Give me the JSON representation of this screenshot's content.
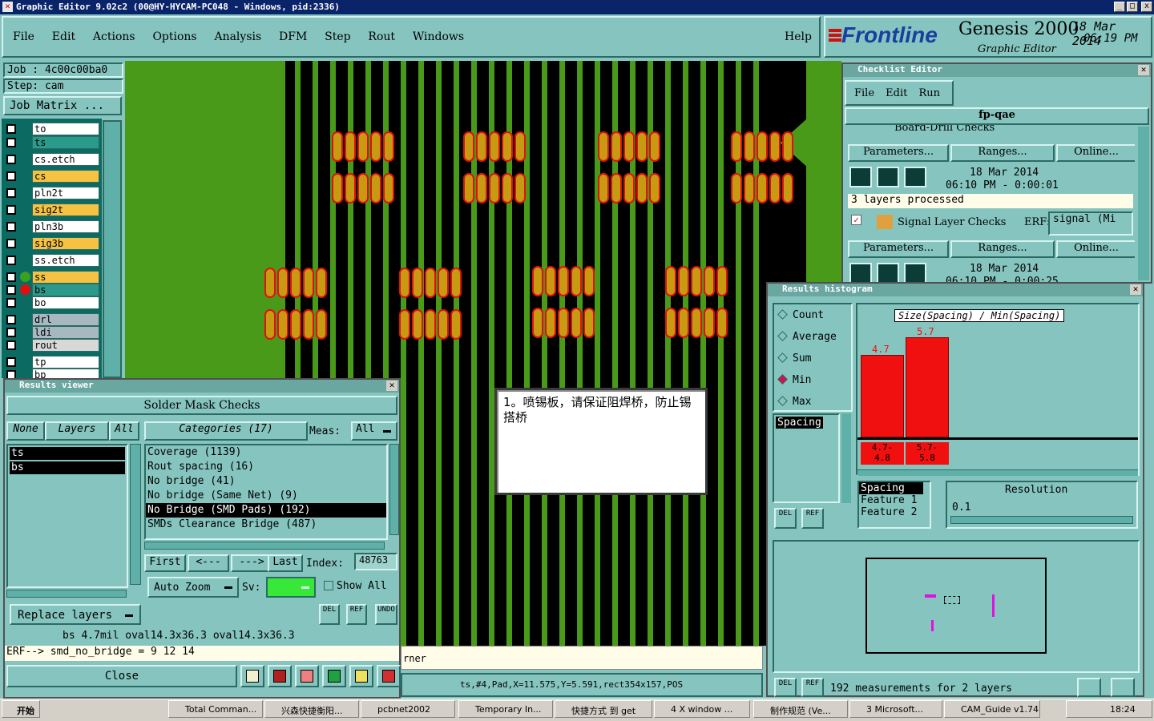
{
  "title": "Graphic Editor 9.02c2  (00@HY-HYCAM-PC048 - Windows, pid:2336)",
  "menu": [
    "File",
    "Edit",
    "Actions",
    "Options",
    "Analysis",
    "DFM",
    "Step",
    "Rout",
    "Windows"
  ],
  "help": "Help",
  "brand": {
    "logo": "Frontline",
    "product": "Genesis 2000",
    "subtitle": "Graphic Editor",
    "date": "18 Mar 2014",
    "time": "06:19 PM"
  },
  "job": {
    "job": "Job : 4c00c00ba0",
    "step": "Step: cam",
    "matrix": "Job Matrix ..."
  },
  "layers": [
    {
      "name": "to",
      "color": "#ffffff"
    },
    {
      "name": "ts",
      "color": "#2a9a8a"
    },
    {
      "name": "cs.etch",
      "color": "#ffffff"
    },
    {
      "name": "cs",
      "color": "#f5c242"
    },
    {
      "name": "pln2t",
      "color": "#ffffff"
    },
    {
      "name": "sig2t",
      "color": "#f5c242"
    },
    {
      "name": "pln3b",
      "color": "#ffffff"
    },
    {
      "name": "sig3b",
      "color": "#f5c242"
    },
    {
      "name": "ss.etch",
      "color": "#ffffff"
    },
    {
      "name": "ss",
      "color": "#f5c242"
    },
    {
      "name": "bs",
      "color": "#2a9a8a"
    },
    {
      "name": "bo",
      "color": "#ffffff"
    },
    {
      "name": "drl",
      "color": "#a8b8c0"
    },
    {
      "name": "ldi",
      "color": "#a8b8c0"
    },
    {
      "name": "rout",
      "color": "#d8d8d8"
    },
    {
      "name": "tp",
      "color": "#ffffff"
    },
    {
      "name": "bp",
      "color": "#ffffff"
    }
  ],
  "checklist": {
    "title": "Checklist Editor",
    "menu": [
      "File",
      "Edit",
      "Run"
    ],
    "name": "fp-qae",
    "section1": "Board-Drill Checks",
    "erf": "ERF:",
    "params": "Parameters...",
    "ranges": "Ranges...",
    "online": "Online...",
    "date1": "18 Mar 2014",
    "time1": "06:10 PM - 0:00:01",
    "processed": "3 layers processed",
    "section2": "Signal Layer Checks",
    "erf_value": "signal (Mi",
    "date2": "18 Mar 2014",
    "time2": "06:10 PM - 0:00:25"
  },
  "histogram": {
    "title": "Results histogram",
    "modes": [
      "Count",
      "Average",
      "Sum",
      "Min",
      "Max"
    ],
    "selected_mode": "Min",
    "chart_title": "Size(Spacing) / Min(Spacing)",
    "spacing": "Spacing",
    "bars": [
      {
        "label": "4.7",
        "range": "4.7-\n4.8"
      },
      {
        "label": "5.7",
        "range": "5.7-\n5.8"
      }
    ],
    "list": [
      "Spacing",
      "Feature 1",
      "Feature 2"
    ],
    "resolution_label": "Resolution",
    "resolution": "0.1",
    "measurements": "192 measurements for 2 layers",
    "del": "DEL",
    "ref": "REF"
  },
  "results_viewer": {
    "title": "Results viewer",
    "header": "Solder Mask Checks",
    "none": "None",
    "layers_tab": "Layers",
    "all": "All",
    "categories": "Categories (17)",
    "meas": "Meas:",
    "meas_value": "All",
    "layer_list": [
      "ts",
      "bs"
    ],
    "category_list": [
      "Coverage (1139)",
      "Rout spacing (16)",
      "No bridge (41)",
      "No bridge (Same Net) (9)",
      "No Bridge (SMD Pads) (192)",
      "SMDs Clearance Bridge (487)"
    ],
    "selected_category": "No Bridge (SMD Pads) (192)",
    "first": "First",
    "prev": "<---",
    "next": "--->",
    "last": "Last",
    "index_label": "Index:",
    "index": "48763",
    "auto_zoom": "Auto Zoom",
    "sv": "Sv:",
    "show_all": "Show All",
    "replace": "Replace layers",
    "status": "bs 4.7mil  oval14.3x36.3  oval14.3x36.3",
    "erf": "ERF--> smd_no_bridge = 9 12 14",
    "close": "Close",
    "del": "DEL",
    "ref": "REF",
    "undo": "UNDO"
  },
  "note": "1。喷锡板，请保证阻焊桥，防止锡搭桥",
  "statusbar": {
    "left": "rner",
    "coords": "ts,#4,Pad,X=11.575,Y=5.591,rect354x157,POS"
  },
  "taskbar": {
    "start": "开始",
    "items": [
      "Total Comman...",
      "兴森快捷衡阳...",
      "pcbnet2002",
      "Temporary In...",
      "快捷方式 到 get",
      "4 X window ...",
      "制作规范 (Ve...",
      "3 Microsoft...",
      "CAM_Guide v1.74"
    ],
    "clock": "18:24"
  }
}
